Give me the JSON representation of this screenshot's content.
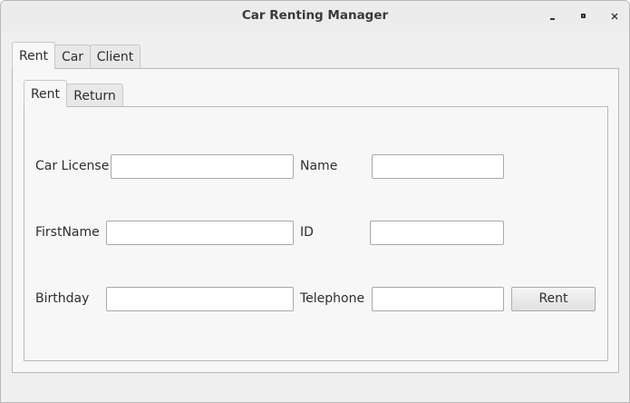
{
  "window": {
    "title": "Car Renting Manager"
  },
  "main_tabs": [
    {
      "label": "Rent"
    },
    {
      "label": "Car"
    },
    {
      "label": "Client"
    }
  ],
  "sub_tabs": [
    {
      "label": "Rent"
    },
    {
      "label": "Return"
    }
  ],
  "form": {
    "car_license": {
      "label": "Car License",
      "value": ""
    },
    "name": {
      "label": "Name",
      "value": ""
    },
    "first_name": {
      "label": "FirstName",
      "value": ""
    },
    "id": {
      "label": "ID",
      "value": ""
    },
    "birthday": {
      "label": "Birthday",
      "value": ""
    },
    "telephone": {
      "label": "Telephone",
      "value": ""
    },
    "rent_button": "Rent"
  }
}
